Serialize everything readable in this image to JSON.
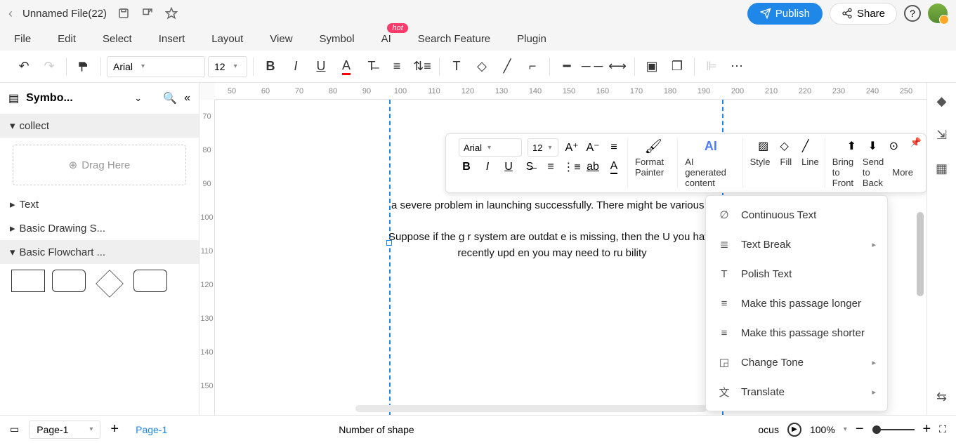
{
  "title": {
    "filename": "Unnamed File(22)"
  },
  "actions": {
    "publish": "Publish",
    "share": "Share"
  },
  "menu": {
    "file": "File",
    "edit": "Edit",
    "select": "Select",
    "insert": "Insert",
    "layout": "Layout",
    "view": "View",
    "symbol": "Symbol",
    "ai": "AI",
    "ai_badge": "hot",
    "search": "Search Feature",
    "plugin": "Plugin"
  },
  "toolbar": {
    "font": "Arial",
    "size": "12"
  },
  "left_panel": {
    "title": "Symbo...",
    "sections": {
      "collect": "collect",
      "text": "Text",
      "basic_drawing": "Basic Drawing S...",
      "basic_flowchart": "Basic Flowchart ..."
    },
    "drag_here": "Drag Here"
  },
  "ruler_h": [
    "50",
    "60",
    "70",
    "80",
    "90",
    "100",
    "110",
    "120",
    "130",
    "140",
    "150",
    "160",
    "170",
    "180",
    "190",
    "200",
    "210",
    "220",
    "230",
    "240",
    "250"
  ],
  "ruler_v": [
    "70",
    "80",
    "90",
    "100",
    "110",
    "120",
    "130",
    "140",
    "150"
  ],
  "text_content": {
    "p1": "a severe problem in launching successfully. There might be various                                              a",
    "p2": "Suppose if the g                                                    r system are outdat                                                    e is missing, then the U                                                    you have recently upd                                                    en you may need to ru                                                    bility"
  },
  "float_toolbar": {
    "font": "Arial",
    "size": "12",
    "format_painter": "Format Painter",
    "ai_content": "AI generated content",
    "style": "Style",
    "fill": "Fill",
    "line": "Line",
    "bring_front": "Bring to Front",
    "send_back": "Send to Back",
    "more": "More"
  },
  "context_menu": {
    "continuous": "Continuous Text",
    "text_break": "Text Break",
    "polish": "Polish Text",
    "longer": "Make this passage longer",
    "shorter": "Make this passage shorter",
    "tone": "Change Tone",
    "translate": "Translate"
  },
  "bottom": {
    "page_select": "Page-1",
    "page_tab": "Page-1",
    "shapes_label": "Number of shape",
    "focus": "ocus",
    "zoom": "100%"
  }
}
